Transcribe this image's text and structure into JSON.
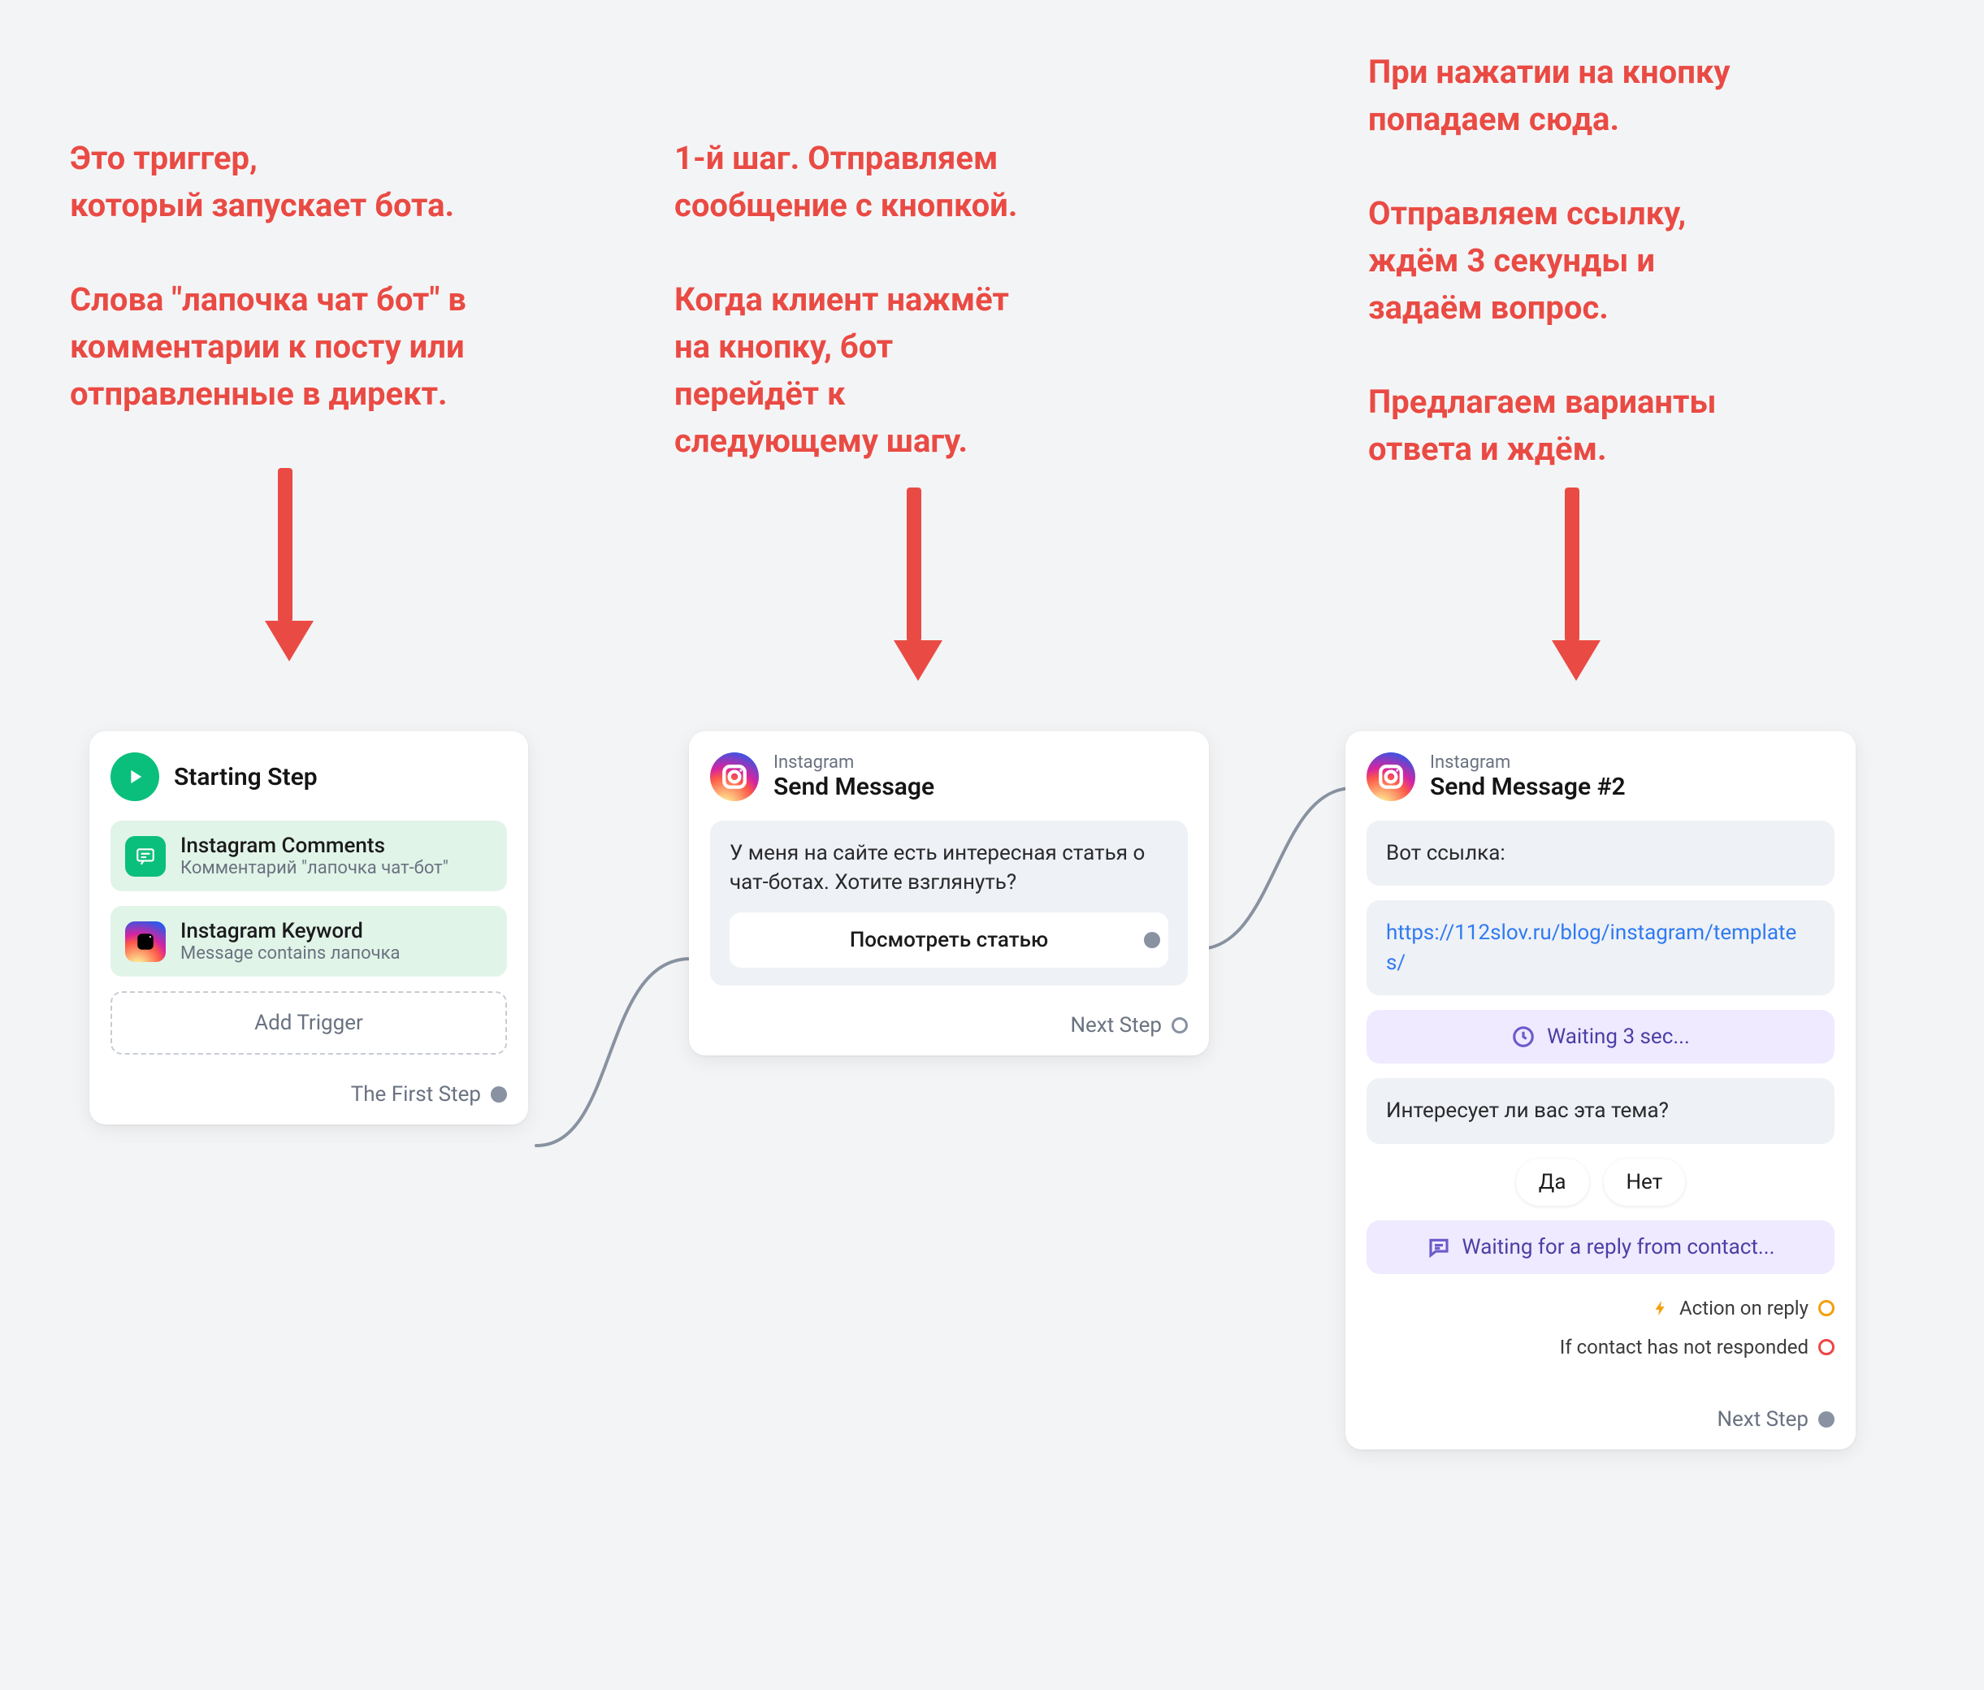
{
  "annotations": {
    "a1": "Это триггер,\nкоторый запускает бота.\n\nСлова \"лапочка чат бот\" в\nкомментарии к посту или\nотправленные в директ.",
    "a2": "1-й шаг. Отправляем\nсообщение с кнопкой.\n\nКогда клиент нажмёт\nна кнопку, бот\nперейдёт к\nследующему шагу.",
    "a3": "При нажатии на кнопку\nпопадаем сюда.\n\nОтправляем ссылку,\nждём 3 секунды и\nзадаём вопрос.\n\nПредлагаем варианты\nответа и ждём."
  },
  "start_card": {
    "title": "Starting Step",
    "trigger1": {
      "title": "Instagram Comments",
      "sub": "Комментарий \"лапочка чат-бот\""
    },
    "trigger2": {
      "title": "Instagram Keyword",
      "sub": "Message contains лапочка"
    },
    "add": "Add Trigger",
    "footer": "The First Step"
  },
  "step1": {
    "platform": "Instagram",
    "title": "Send Message",
    "msg": "У меня на сайте есть интересная статья о чат-ботах. Хотите взглянуть?",
    "btn": "Посмотреть статью",
    "footer": "Next Step"
  },
  "step2": {
    "platform": "Instagram",
    "title": "Send Message #2",
    "msg1": "Вот ссылка:",
    "link": "https://112slov.ru/blog/instagram/templates/",
    "wait": "Waiting 3 sec...",
    "msg2": "Интересует ли вас эта тема?",
    "replies": {
      "yes": "Да",
      "no": "Нет"
    },
    "waiting_reply": "Waiting for a reply from contact...",
    "action_reply": "Action on reply",
    "no_response": "If contact has not responded",
    "footer": "Next Step"
  }
}
